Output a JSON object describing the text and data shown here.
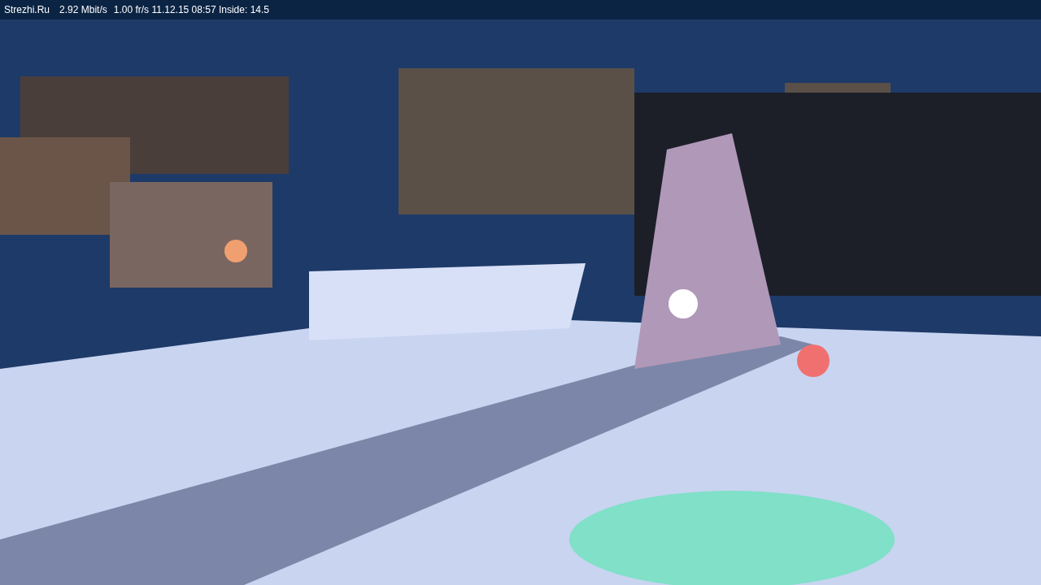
{
  "overlay": {
    "site": "Strezhi.Ru",
    "bitrate": "2.92 Mbit/s",
    "framerate": "1.00 fr/s",
    "timestamp": "11.12.15 08:57",
    "sensor": "Inside: 14.5"
  }
}
